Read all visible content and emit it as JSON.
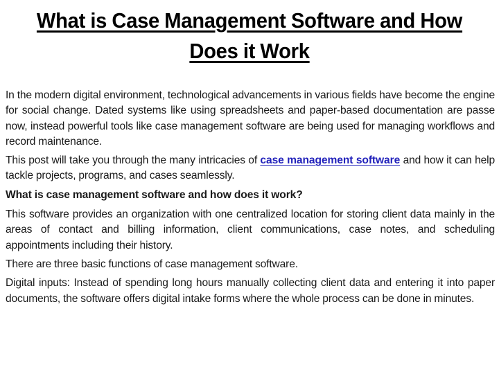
{
  "document": {
    "background_color": "#ffffff",
    "text_color": "#1a1a1a",
    "link_color": "#2222bb"
  },
  "title": {
    "line1": "What is Case Management Software and",
    "line2": "How Does it Work",
    "full": "What is Case Management Software and How Does it Work",
    "style": "bold-underline-centered"
  },
  "content": {
    "paragraph_1": "In the modern digital environment, technological advancements in various fields have become the engine for social change. Dated systems like using spreadsheets and paper-based documentation are passe now, instead powerful tools like case management software are being used for managing workflows and record maintenance.",
    "paragraph_2_before_link": "This post will take you through the many intricacies of ",
    "paragraph_2_link": "case management software",
    "paragraph_2_after_link": " and how it can help tackle projects, programs, and cases seamlessly.",
    "heading_1": "What is case management software and how does it work?",
    "paragraph_3": "This software provides an organization with one centralized location for storing client data mainly in the areas of contact and billing information, client communications, case notes, and scheduling appointments including their history.",
    "paragraph_4": "There are three basic functions of case management software.",
    "paragraph_5": "Digital inputs: Instead of spending long hours manually collecting client data and entering it into paper documents, the software offers digital intake forms where the whole process can be done in minutes."
  }
}
